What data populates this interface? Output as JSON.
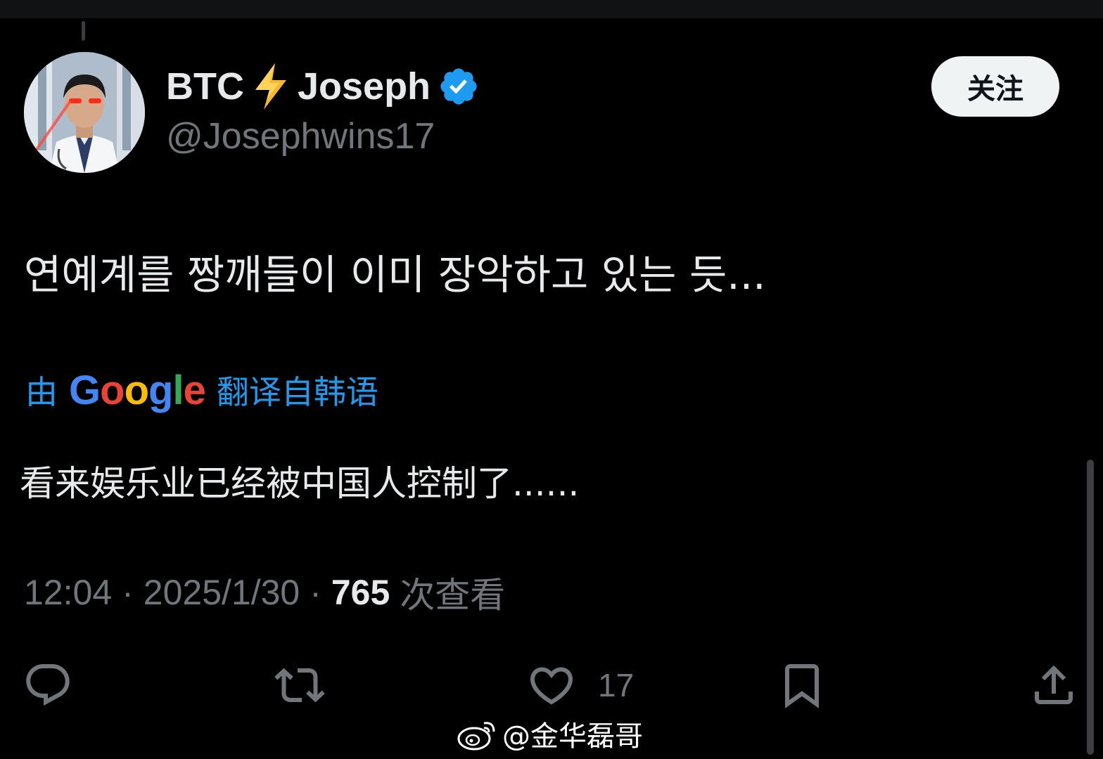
{
  "author": {
    "name_part1": "BTC",
    "name_part2": "Joseph",
    "handle": "@Josephwins17"
  },
  "follow_label": "关注",
  "tweet_text": "연예계를 짱깨들이 이미 장악하고 있는 듯...",
  "translation": {
    "prefix": "由",
    "google_letters": [
      "G",
      "o",
      "o",
      "g",
      "l",
      "e"
    ],
    "suffix": "翻译自韩语",
    "text": "看来娱乐业已经被中国人控制了......"
  },
  "meta": {
    "time": "12:04",
    "separator": "·",
    "date": "2025/1/30",
    "views": "765",
    "views_label": "次查看"
  },
  "actions": {
    "like_count": "17"
  },
  "watermark": "@金华磊哥",
  "colors": {
    "background": "#000000",
    "text": "#e7e9ea",
    "muted": "#71767b",
    "accent": "#1d9bf0",
    "verified": "#1d9bf0",
    "bolt": "#f7b733"
  },
  "icons": [
    "reply-icon",
    "retweet-icon",
    "heart-icon",
    "bookmark-icon",
    "share-icon",
    "verified-badge-icon",
    "lightning-bolt-icon",
    "weibo-logo-icon"
  ]
}
